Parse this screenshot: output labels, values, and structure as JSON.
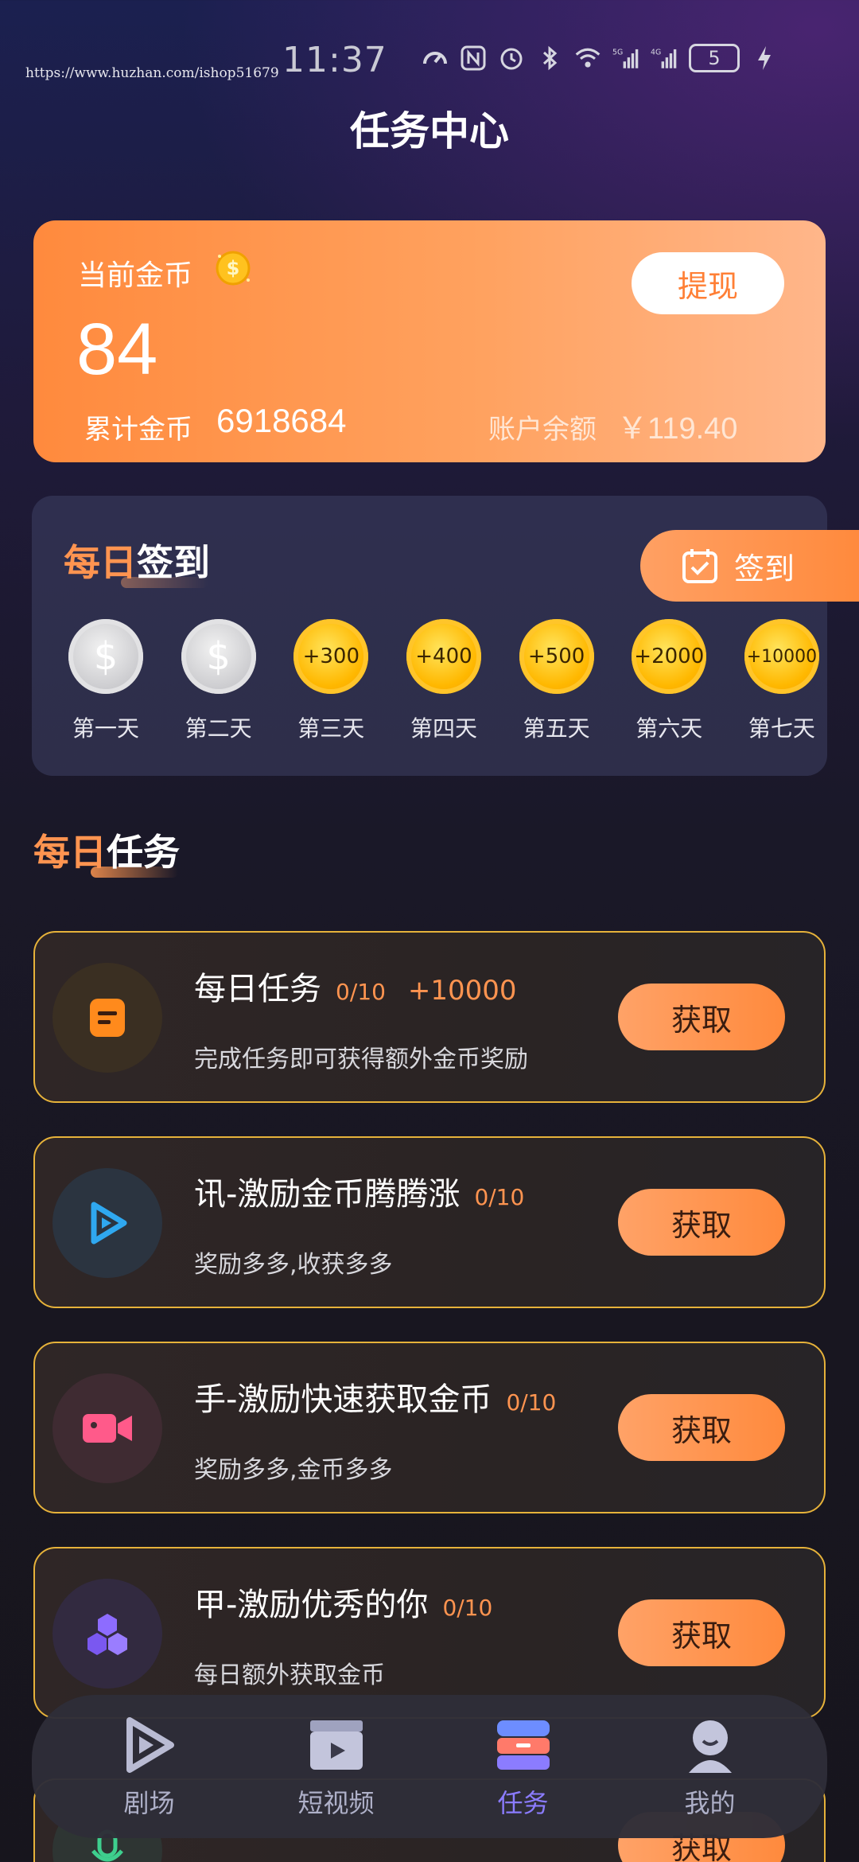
{
  "watermark": "https://www.huzhan.com/ishop51679",
  "status_bar": {
    "time": "11:37",
    "battery": "5",
    "icons": [
      "speed-icon",
      "nfc-icon",
      "alarm-icon",
      "bluetooth-icon",
      "wifi-icon",
      "signal-5g-icon",
      "signal-4g-icon",
      "battery-icon",
      "charging-icon"
    ]
  },
  "page": {
    "title": "任务中心"
  },
  "coin_card": {
    "current_label": "当前金币",
    "current_value": "84",
    "withdraw_label": "提现",
    "total_label": "累计金币",
    "total_value": "6918684",
    "balance_label": "账户余额",
    "balance_value": "￥119.40"
  },
  "signin": {
    "title_accent": "每日",
    "title_rest": "签到",
    "button_label": "签到",
    "days": [
      {
        "label": "第一天",
        "reward": "$",
        "style": "silver"
      },
      {
        "label": "第二天",
        "reward": "$",
        "style": "silver"
      },
      {
        "label": "第三天",
        "reward": "+300",
        "style": "gold"
      },
      {
        "label": "第四天",
        "reward": "+400",
        "style": "gold"
      },
      {
        "label": "第五天",
        "reward": "+500",
        "style": "gold"
      },
      {
        "label": "第六天",
        "reward": "+2000",
        "style": "gold"
      },
      {
        "label": "第七天",
        "reward": "+10000",
        "style": "gold"
      }
    ]
  },
  "tasks_section": {
    "title_accent": "每日",
    "title_rest": "任务",
    "items": [
      {
        "title": "每日任务",
        "progress": "0/10",
        "bonus": "+10000",
        "desc": "完成任务即可获得额外金币奖励",
        "button": "获取",
        "icon": "document-icon"
      },
      {
        "title": "讯-激励金币腾腾涨",
        "progress": "0/10",
        "bonus": "",
        "desc": "奖励多多,收获多多",
        "button": "获取",
        "icon": "play-icon"
      },
      {
        "title": "手-激励快速获取金币",
        "progress": "0/10",
        "bonus": "",
        "desc": "奖励多多,金币多多",
        "button": "获取",
        "icon": "video-camera-icon"
      },
      {
        "title": "甲-激励优秀的你",
        "progress": "0/10",
        "bonus": "",
        "desc": "每日额外获取金币",
        "button": "获取",
        "icon": "cubes-icon"
      }
    ],
    "partial_button": "获取"
  },
  "bottom_nav": {
    "items": [
      {
        "label": "剧场",
        "icon": "theater-play-icon",
        "active": false
      },
      {
        "label": "短视频",
        "icon": "clapperboard-icon",
        "active": false
      },
      {
        "label": "任务",
        "icon": "tasks-icon",
        "active": true
      },
      {
        "label": "我的",
        "icon": "profile-icon",
        "active": false
      }
    ]
  },
  "colors": {
    "accent": "#ff8a3d",
    "active_nav": "#8b7cff",
    "task_border": "#e6b23a"
  }
}
